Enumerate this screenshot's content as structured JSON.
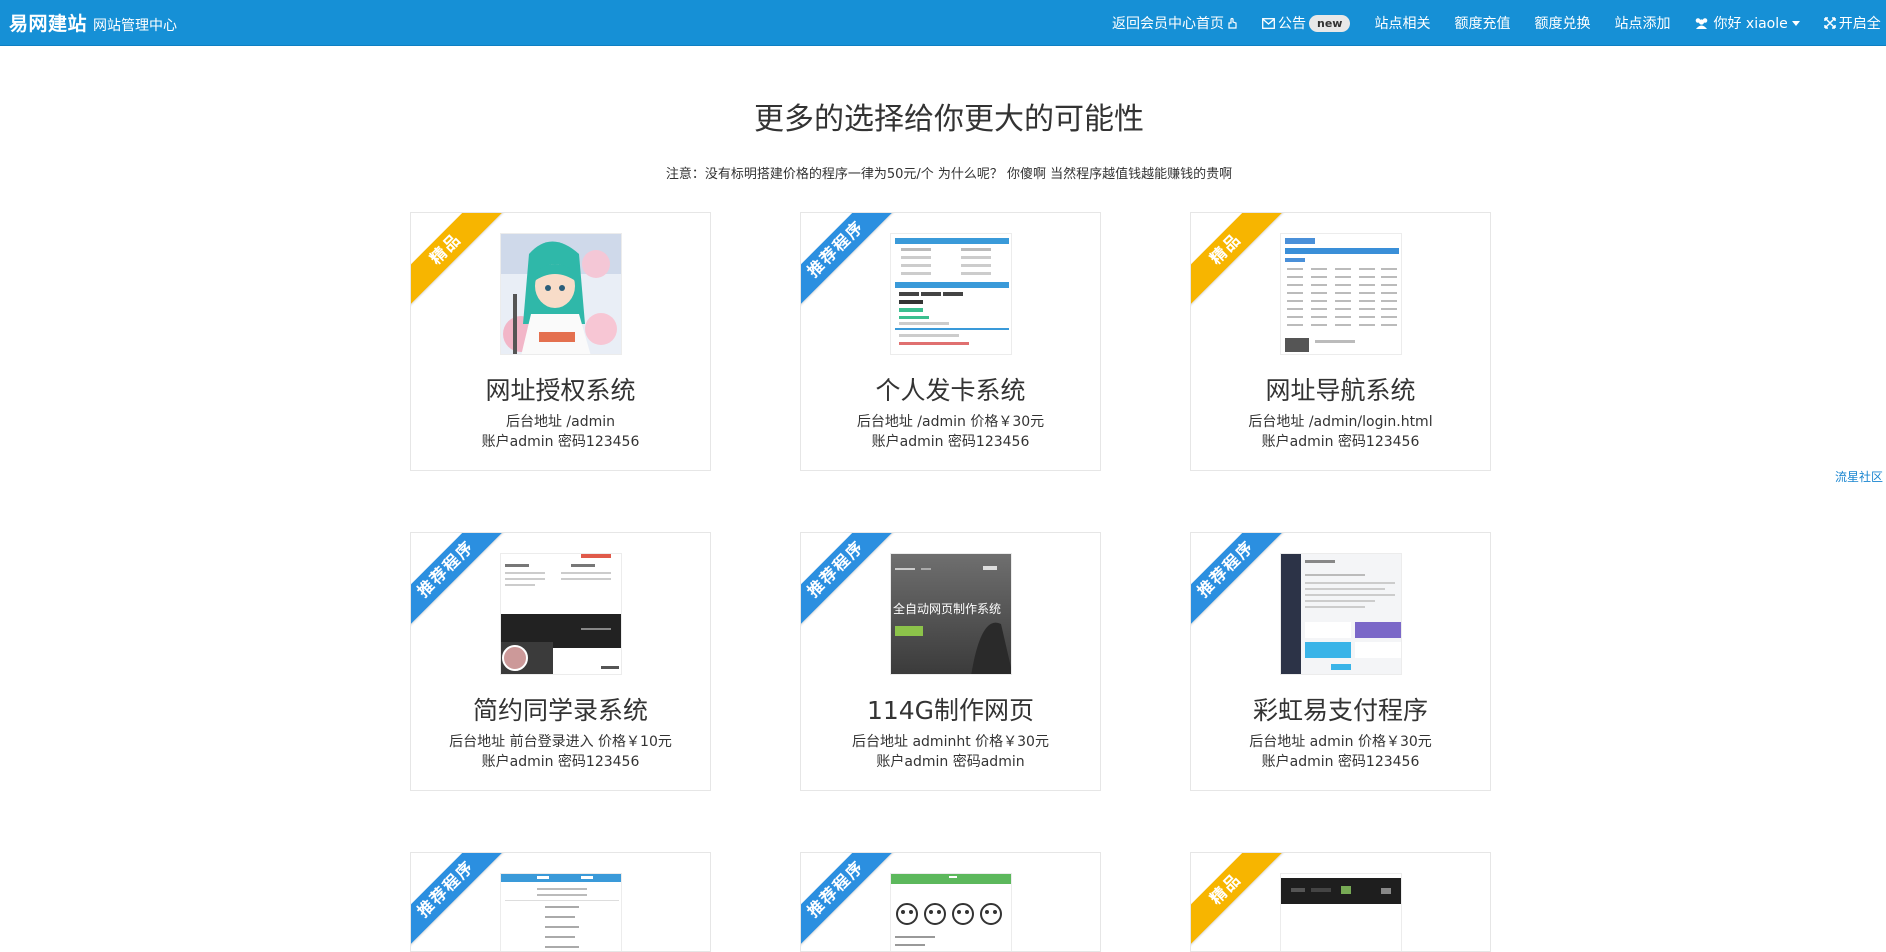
{
  "navbar": {
    "brand_main": "易网建站",
    "brand_sub": "网站管理中心",
    "items": [
      {
        "label": "返回会员中心首页",
        "icon": "hand-pointer-icon"
      },
      {
        "label": "公告",
        "icon": "envelope-icon",
        "badge": "new"
      },
      {
        "label": "站点相关"
      },
      {
        "label": "额度充值"
      },
      {
        "label": "额度兑换"
      },
      {
        "label": "站点添加"
      },
      {
        "label": "你好 xiaole",
        "icon": "users-icon",
        "dropdown": true
      },
      {
        "label": "开启全",
        "icon": "fullscreen-icon"
      }
    ]
  },
  "page": {
    "title": "更多的选择给你更大的可能性",
    "note": "注意：没有标明搭建价格的程序一律为50元/个 为什么呢？ 你傻啊 当然程序越值钱越能赚钱的贵啊"
  },
  "side_link": "流星社区",
  "colors": {
    "navbar": "#1690d6",
    "ribbon_gold": "#f7b500",
    "ribbon_blue": "#2b8fe0"
  },
  "cards": [
    {
      "ribbon": "精品",
      "ribbon_color": "gold",
      "title": "网址授权系统",
      "line1": "后台地址 /admin",
      "line2": "账户admin 密码123456",
      "thumb": "anime"
    },
    {
      "ribbon": "推荐程序",
      "ribbon_color": "blue",
      "title": "个人发卡系统",
      "line1": "后台地址 /admin 价格￥30元",
      "line2": "账户admin 密码123456",
      "thumb": "form"
    },
    {
      "ribbon": "精品",
      "ribbon_color": "gold",
      "title": "网址导航系统",
      "line1": "后台地址 /admin/login.html",
      "line2": "账户admin 密码123456",
      "thumb": "table"
    },
    {
      "ribbon": "推荐程序",
      "ribbon_color": "blue",
      "title": "简约同学录系统",
      "line1": "后台地址 前台登录进入 价格￥10元",
      "line2": "账户admin 密码123456",
      "thumb": "classmate"
    },
    {
      "ribbon": "推荐程序",
      "ribbon_color": "blue",
      "title": "114G制作网页",
      "line1": "后台地址 adminht 价格￥30元",
      "line2": "账户admin 密码admin",
      "thumb": "dark",
      "thumb_text": "全自动网页制作系统"
    },
    {
      "ribbon": "推荐程序",
      "ribbon_color": "blue",
      "title": "彩虹易支付程序",
      "line1": "后台地址 admin 价格￥30元",
      "line2": "账户admin 密码123456",
      "thumb": "dashboard"
    },
    {
      "ribbon": "推荐程序",
      "ribbon_color": "blue",
      "title": "",
      "line1": "",
      "line2": "",
      "thumb": "list"
    },
    {
      "ribbon": "推荐程序",
      "ribbon_color": "blue",
      "title": "",
      "line1": "",
      "line2": "",
      "thumb": "faces"
    },
    {
      "ribbon": "精品",
      "ribbon_color": "gold",
      "title": "",
      "line1": "",
      "line2": "",
      "thumb": "blackbar"
    }
  ]
}
